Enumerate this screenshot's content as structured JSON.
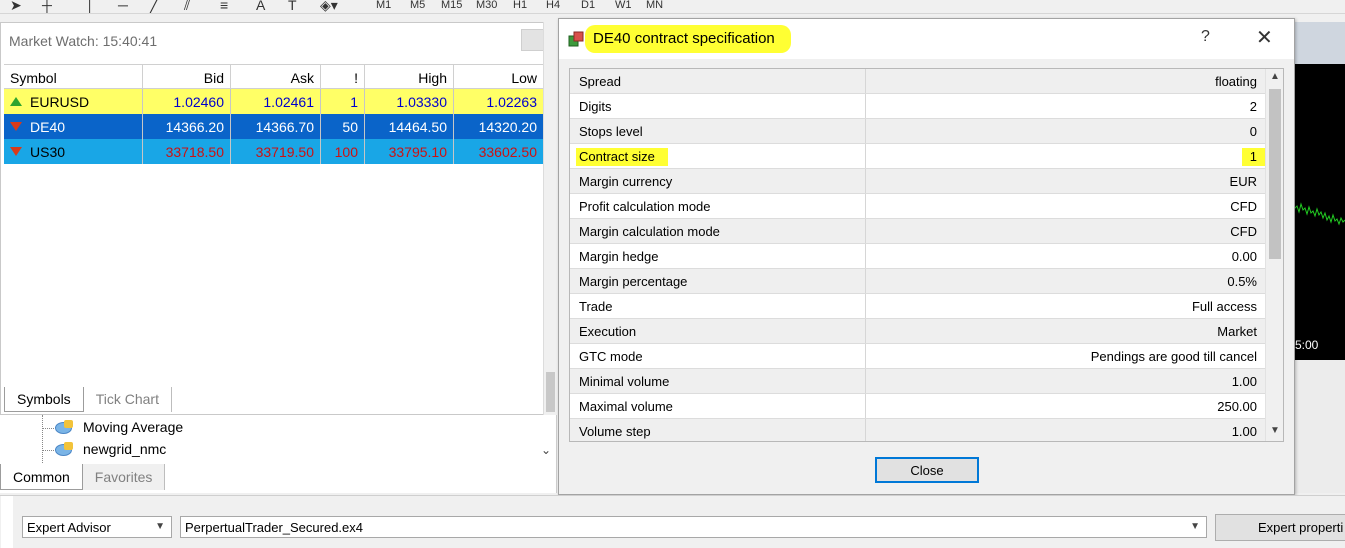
{
  "toolbar": {
    "timeframes": [
      "M1",
      "M5",
      "M15",
      "M30",
      "H1",
      "H4",
      "D1",
      "W1",
      "MN"
    ]
  },
  "market_watch": {
    "title": "Market Watch: 15:40:41",
    "columns": [
      "Symbol",
      "Bid",
      "Ask",
      "!",
      "High",
      "Low"
    ],
    "rows": [
      {
        "symbol": "EURUSD",
        "bid": "1.02460",
        "ask": "1.02461",
        "spread": "1",
        "high": "1.03330",
        "low": "1.02263",
        "direction": "up"
      },
      {
        "symbol": "DE40",
        "bid": "14366.20",
        "ask": "14366.70",
        "spread": "50",
        "high": "14464.50",
        "low": "14320.20",
        "direction": "down"
      },
      {
        "symbol": "US30",
        "bid": "33718.50",
        "ask": "33719.50",
        "spread": "100",
        "high": "33795.10",
        "low": "33602.50",
        "direction": "down"
      }
    ],
    "tabs": [
      "Symbols",
      "Tick Chart"
    ]
  },
  "navigator": {
    "items": [
      "Moving Average",
      "newgrid_nmc"
    ],
    "tabs": [
      "Common",
      "Favorites"
    ]
  },
  "chart": {
    "time_label": "5:00"
  },
  "dialog": {
    "title": "DE40 contract specification",
    "help": "?",
    "close_glyph": "✕",
    "rows": [
      {
        "key": "Spread",
        "value": "floating"
      },
      {
        "key": "Digits",
        "value": "2"
      },
      {
        "key": "Stops level",
        "value": "0"
      },
      {
        "key": "Contract size",
        "value": "1"
      },
      {
        "key": "Margin currency",
        "value": "EUR"
      },
      {
        "key": "Profit calculation mode",
        "value": "CFD"
      },
      {
        "key": "Margin calculation mode",
        "value": "CFD"
      },
      {
        "key": "Margin hedge",
        "value": "0.00"
      },
      {
        "key": "Margin percentage",
        "value": "0.5%"
      },
      {
        "key": "Trade",
        "value": "Full access"
      },
      {
        "key": "Execution",
        "value": "Market"
      },
      {
        "key": "GTC mode",
        "value": "Pendings are good till cancel"
      },
      {
        "key": "Minimal volume",
        "value": "1.00"
      },
      {
        "key": "Maximal volume",
        "value": "250.00"
      },
      {
        "key": "Volume step",
        "value": "1.00"
      }
    ],
    "close_button": "Close"
  },
  "tester": {
    "type_select": "Expert Advisor",
    "file": "PerpertualTrader_Secured.ex4",
    "props_button": "Expert properti"
  },
  "colors": {
    "highlight": "#ffff33",
    "row_selected": "#0a64c9",
    "row_cyan": "#19a6e6",
    "row_yellow": "#ffff66",
    "button_focus": "#0078d7"
  }
}
